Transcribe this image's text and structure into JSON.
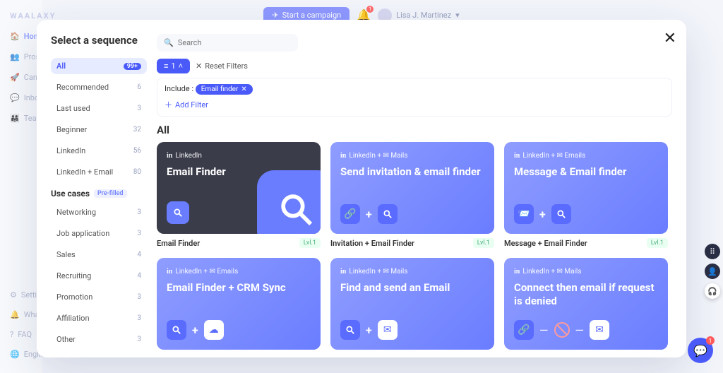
{
  "app": {
    "logo": "WAALAXY"
  },
  "bgNav": {
    "items": [
      {
        "icon": "home",
        "label": "Home"
      },
      {
        "icon": "users",
        "label": "Prospects"
      },
      {
        "icon": "rocket",
        "label": "Campaigns"
      },
      {
        "icon": "chat",
        "label": "Inbox"
      },
      {
        "icon": "team",
        "label": "Team"
      }
    ],
    "bottom": [
      {
        "icon": "gear",
        "label": "Settings"
      },
      {
        "icon": "bell",
        "label": "What's new"
      },
      {
        "icon": "help",
        "label": "FAQ"
      },
      {
        "icon": "globe",
        "label": "English"
      }
    ]
  },
  "bgHeader": {
    "campaignBtn": "Start a campaign",
    "bellCount": "1",
    "userName": "Lisa J. Martinez"
  },
  "modal": {
    "title": "Select a sequence",
    "search": {
      "placeholder": "Search"
    },
    "categories": [
      {
        "label": "All",
        "count": "99+",
        "selected": true
      },
      {
        "label": "Recommended",
        "count": "6"
      },
      {
        "label": "Last used",
        "count": "3"
      },
      {
        "label": "Beginner",
        "count": "32"
      },
      {
        "label": "LinkedIn",
        "count": "56"
      },
      {
        "label": "LinkedIn + Email",
        "count": "80"
      }
    ],
    "useCases": {
      "title": "Use cases",
      "prefilled": "Pre-filled",
      "items": [
        {
          "label": "Networking",
          "count": "3"
        },
        {
          "label": "Job application",
          "count": "3"
        },
        {
          "label": "Sales",
          "count": "4"
        },
        {
          "label": "Recruiting",
          "count": "4"
        },
        {
          "label": "Promotion",
          "count": "3"
        },
        {
          "label": "Affiliation",
          "count": "3"
        },
        {
          "label": "Other",
          "count": "3"
        }
      ]
    },
    "filters": {
      "denseBtn": "1",
      "reset": "Reset Filters",
      "includeLabel": "Include :",
      "chip": "Email finder",
      "addFilter": "Add Filter"
    },
    "sectionTitle": "All",
    "cards": [
      {
        "style": "dark",
        "tag": "LinkedIn",
        "title": "Email Finder",
        "footer": "Email Finder",
        "lvl": "Lvl.1",
        "layout": "darkmag"
      },
      {
        "style": "blue",
        "tag": "LinkedIn + ✉ Mails",
        "title": "Send invitation & email finder",
        "footer": "Invitation + Email Finder",
        "lvl": "Lvl.1",
        "layout": "link+search"
      },
      {
        "style": "blue",
        "tag": "LinkedIn + ✉ Emails",
        "title": "Message & Email finder",
        "footer": "Message + Email Finder",
        "lvl": "Lvl.1",
        "layout": "send+search"
      },
      {
        "style": "blue",
        "tag": "LinkedIn + ✉ Emails",
        "title": "Email Finder + CRM Sync",
        "footer": "",
        "lvl": "",
        "layout": "search+cloud"
      },
      {
        "style": "blue",
        "tag": "LinkedIn + ✉ Mails",
        "title": "Find and send an Email",
        "footer": "",
        "lvl": "",
        "layout": "search+mail"
      },
      {
        "style": "blue",
        "tag": "LinkedIn + ✉ Mails",
        "title": "Connect then email if request is denied",
        "footer": "",
        "lvl": "",
        "layout": "link-deny-mail"
      }
    ]
  },
  "chat": {
    "count": "1"
  }
}
